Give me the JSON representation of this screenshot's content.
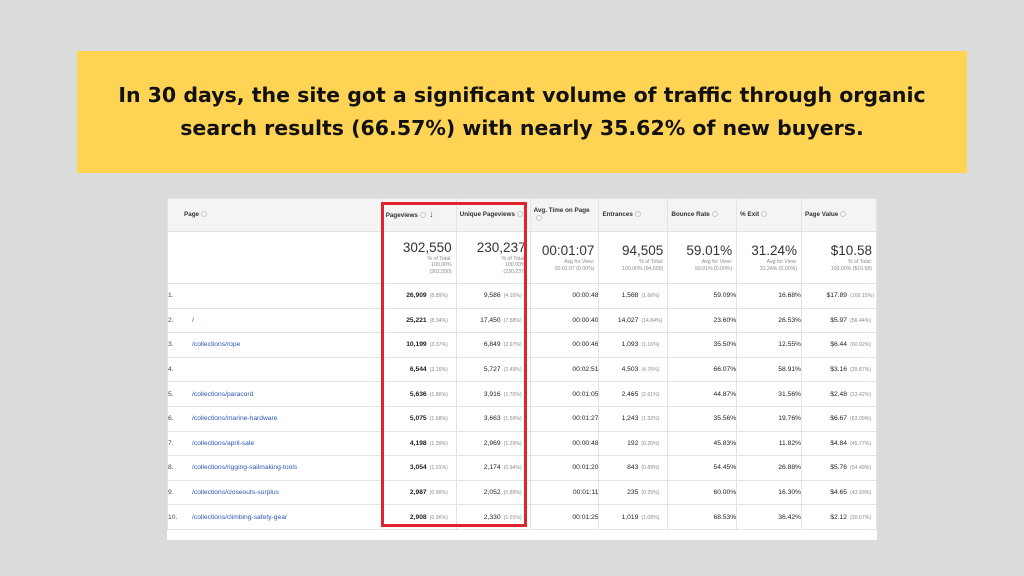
{
  "banner": {
    "line1": "In 30 days, the site got a significant volume of traffic through organic",
    "line2": "search results (66.57%) with nearly 35.62% of new buyers."
  },
  "table": {
    "headers": {
      "page": "Page",
      "pageviews": "Pageviews",
      "unique_pageviews": "Unique Pageviews",
      "avg_time": "Avg. Time on Page",
      "entrances": "Entrances",
      "bounce_rate": "Bounce Rate",
      "exit": "% Exit",
      "page_value": "Page Value"
    },
    "totals": {
      "pageviews": {
        "value": "302,550",
        "l1": "% of Total:",
        "l2": "100.00%",
        "l3": "(302,550)"
      },
      "unique_pageviews": {
        "value": "230,237",
        "l1": "% of Total:",
        "l2": "100.00%",
        "l3": "(230,237)"
      },
      "avg_time": {
        "value": "00:01:07",
        "l1": "Avg for View:",
        "l2": "00:01:07 (0.00%)"
      },
      "entrances": {
        "value": "94,505",
        "l1": "% of Total:",
        "l2": "100.00% (94,505)"
      },
      "bounce_rate": {
        "value": "59.01%",
        "l1": "Avg for View:",
        "l2": "59.01% (0.00%)"
      },
      "exit": {
        "value": "31.24%",
        "l1": "Avg for View:",
        "l2": "31.24% (0.00%)"
      },
      "page_value": {
        "value": "$10.58",
        "l1": "% of Total:",
        "l2": "100.00% ($10.58)"
      }
    },
    "rows": [
      {
        "n": "1.",
        "page": "",
        "pv": "26,909",
        "pv_pct": "(8.89%)",
        "upv": "9,586",
        "upv_pct": "(4.16%)",
        "time": "00:00:48",
        "ent": "1,568",
        "ent_pct": "(1.66%)",
        "bounce": "59.09%",
        "exit": "16.68%",
        "val": "$17.89",
        "val_pct": "(169.15%)"
      },
      {
        "n": "2.",
        "page": "/",
        "pv": "25,221",
        "pv_pct": "(8.34%)",
        "upv": "17,450",
        "upv_pct": "(7.58%)",
        "time": "00:00:40",
        "ent": "14,027",
        "ent_pct": "(14.84%)",
        "bounce": "23.60%",
        "exit": "26.53%",
        "val": "$5.97",
        "val_pct": "(56.44%)"
      },
      {
        "n": "3.",
        "page": "/collections/rope",
        "pv": "10,199",
        "pv_pct": "(3.37%)",
        "upv": "6,849",
        "upv_pct": "(2.97%)",
        "time": "00:00:46",
        "ent": "1,093",
        "ent_pct": "(1.16%)",
        "bounce": "35.50%",
        "exit": "12.55%",
        "val": "$6.44",
        "val_pct": "(60.92%)"
      },
      {
        "n": "4.",
        "page": "",
        "pv": "6,544",
        "pv_pct": "(2.16%)",
        "upv": "5,727",
        "upv_pct": "(2.49%)",
        "time": "00:02:51",
        "ent": "4,503",
        "ent_pct": "(4.76%)",
        "bounce": "66.07%",
        "exit": "58.91%",
        "val": "$3.16",
        "val_pct": "(29.87%)"
      },
      {
        "n": "5.",
        "page": "/collections/paracord",
        "pv": "5,636",
        "pv_pct": "(1.86%)",
        "upv": "3,916",
        "upv_pct": "(1.70%)",
        "time": "00:01:05",
        "ent": "2,465",
        "ent_pct": "(2.61%)",
        "bounce": "44.87%",
        "exit": "31.56%",
        "val": "$2.48",
        "val_pct": "(23.42%)"
      },
      {
        "n": "6.",
        "page": "/collections/marine-hardware",
        "pv": "5,075",
        "pv_pct": "(1.68%)",
        "upv": "3,663",
        "upv_pct": "(1.59%)",
        "time": "00:01:27",
        "ent": "1,243",
        "ent_pct": "(1.32%)",
        "bounce": "35.56%",
        "exit": "19.76%",
        "val": "$6.67",
        "val_pct": "(63.09%)"
      },
      {
        "n": "7.",
        "page": "/collections/april-sale",
        "pv": "4,198",
        "pv_pct": "(1.39%)",
        "upv": "2,969",
        "upv_pct": "(1.29%)",
        "time": "00:00:48",
        "ent": "192",
        "ent_pct": "(0.20%)",
        "bounce": "45.83%",
        "exit": "11.82%",
        "val": "$4.84",
        "val_pct": "(45.77%)"
      },
      {
        "n": "8.",
        "page": "/collections/rigging-sailmaking-tools",
        "pv": "3,054",
        "pv_pct": "(1.01%)",
        "upv": "2,174",
        "upv_pct": "(0.94%)",
        "time": "00:01:20",
        "ent": "843",
        "ent_pct": "(0.89%)",
        "bounce": "54.45%",
        "exit": "26.88%",
        "val": "$5.76",
        "val_pct": "(54.49%)"
      },
      {
        "n": "9.",
        "page": "/collections/closeouts-surplus",
        "pv": "2,987",
        "pv_pct": "(0.99%)",
        "upv": "2,052",
        "upv_pct": "(0.89%)",
        "time": "00:01:11",
        "ent": "235",
        "ent_pct": "(0.25%)",
        "bounce": "60.00%",
        "exit": "16.30%",
        "val": "$4.65",
        "val_pct": "(43.93%)"
      },
      {
        "n": "10.",
        "page": "/collections/climbing-safety-gear",
        "pv": "2,908",
        "pv_pct": "(0.96%)",
        "upv": "2,330",
        "upv_pct": "(1.01%)",
        "time": "00:01:25",
        "ent": "1,019",
        "ent_pct": "(1.08%)",
        "bounce": "68.53%",
        "exit": "36.42%",
        "val": "$2.12",
        "val_pct": "(20.07%)"
      }
    ]
  }
}
